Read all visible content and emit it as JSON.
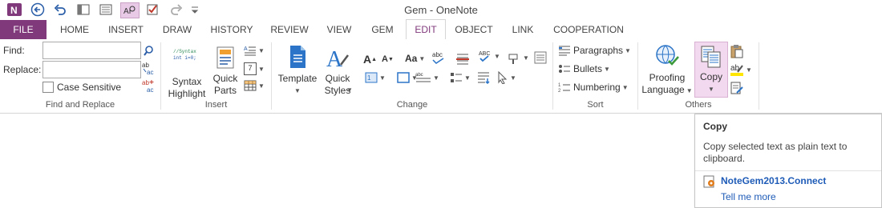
{
  "window": {
    "title": "Gem - OneNote"
  },
  "quick_access": {
    "icons": [
      "onenote-logo-icon",
      "back-icon",
      "undo-icon",
      "dock-icon",
      "page-icon",
      "search-text-icon",
      "check-icon",
      "redo-icon",
      "customize-icon"
    ]
  },
  "tabs": [
    "FILE",
    "HOME",
    "INSERT",
    "DRAW",
    "HISTORY",
    "REVIEW",
    "VIEW",
    "GEM",
    "EDIT",
    "OBJECT",
    "LINK",
    "COOPERATION"
  ],
  "active_tab": "EDIT",
  "colors": {
    "file_tab": "#80397b",
    "accent": "#80397b",
    "highlight_button": "#f2d9ef",
    "link": "#1e5bb7"
  },
  "groups": {
    "find_replace": {
      "label": "Find and Replace",
      "find_label": "Find:",
      "replace_label": "Replace:",
      "find_value": "",
      "replace_value": "",
      "case_sensitive_label": "Case Sensitive"
    },
    "insert": {
      "label": "Insert",
      "syntax_highlight_label1": "Syntax",
      "syntax_highlight_label2": "Highlight",
      "syntax_preview_line1": "//Syntax",
      "syntax_preview_line2": "int i=0;",
      "quick_parts_label1": "Quick",
      "quick_parts_label2": "Parts",
      "calendar_number": "7"
    },
    "change": {
      "label": "Change",
      "template_label": "Template",
      "quick_styles_label1": "Quick",
      "quick_styles_label2": "Styles",
      "font_grow": "A",
      "font_shrink": "A",
      "change_case": "Aa",
      "abc": "abc",
      "abc_caps": "ABC"
    },
    "sort": {
      "label": "Sort",
      "paragraphs_label": "Paragraphs",
      "bullets_label": "Bullets",
      "numbering_label": "Numbering"
    },
    "others": {
      "label": "Others",
      "proofing_label1": "Proofing",
      "proofing_label2": "Language",
      "copy_label": "Copy"
    }
  },
  "tooltip": {
    "title": "Copy",
    "description": "Copy selected text as plain text to clipboard.",
    "addin": "NoteGem2013.Connect",
    "link": "Tell me more"
  }
}
